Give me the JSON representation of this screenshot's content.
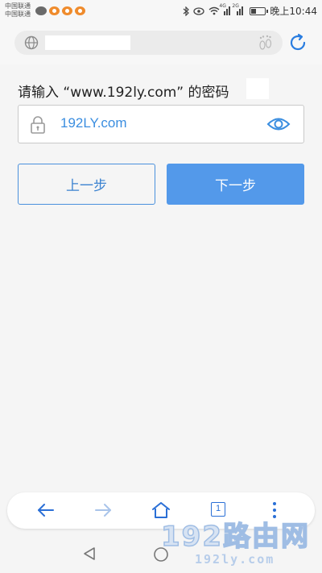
{
  "status_bar": {
    "carrier_1": "中国联通",
    "carrier_2": "中国联通",
    "network_1": "4G",
    "network_2": "2G",
    "time": "晚上10:44"
  },
  "browser": {
    "url_placeholder": ""
  },
  "form": {
    "prompt": "请输入 “www.192ly.com” 的密码",
    "password_value": "192LY.com",
    "prev_button": "上一步",
    "next_button": "下一步"
  },
  "toolbar": {
    "tab_count": "1"
  },
  "watermark": {
    "title": "192路由网",
    "site": "192ly.com"
  },
  "colors": {
    "accent": "#5399ea",
    "link": "#3b8ee0",
    "toolbar_icon": "#2a6fd6"
  },
  "icons": [
    "globe-icon",
    "paw-icon",
    "refresh-icon",
    "lock-icon",
    "eye-icon",
    "back-arrow-icon",
    "forward-arrow-icon",
    "home-icon",
    "tabs-icon",
    "more-icon",
    "nav-back-icon",
    "nav-home-icon"
  ]
}
